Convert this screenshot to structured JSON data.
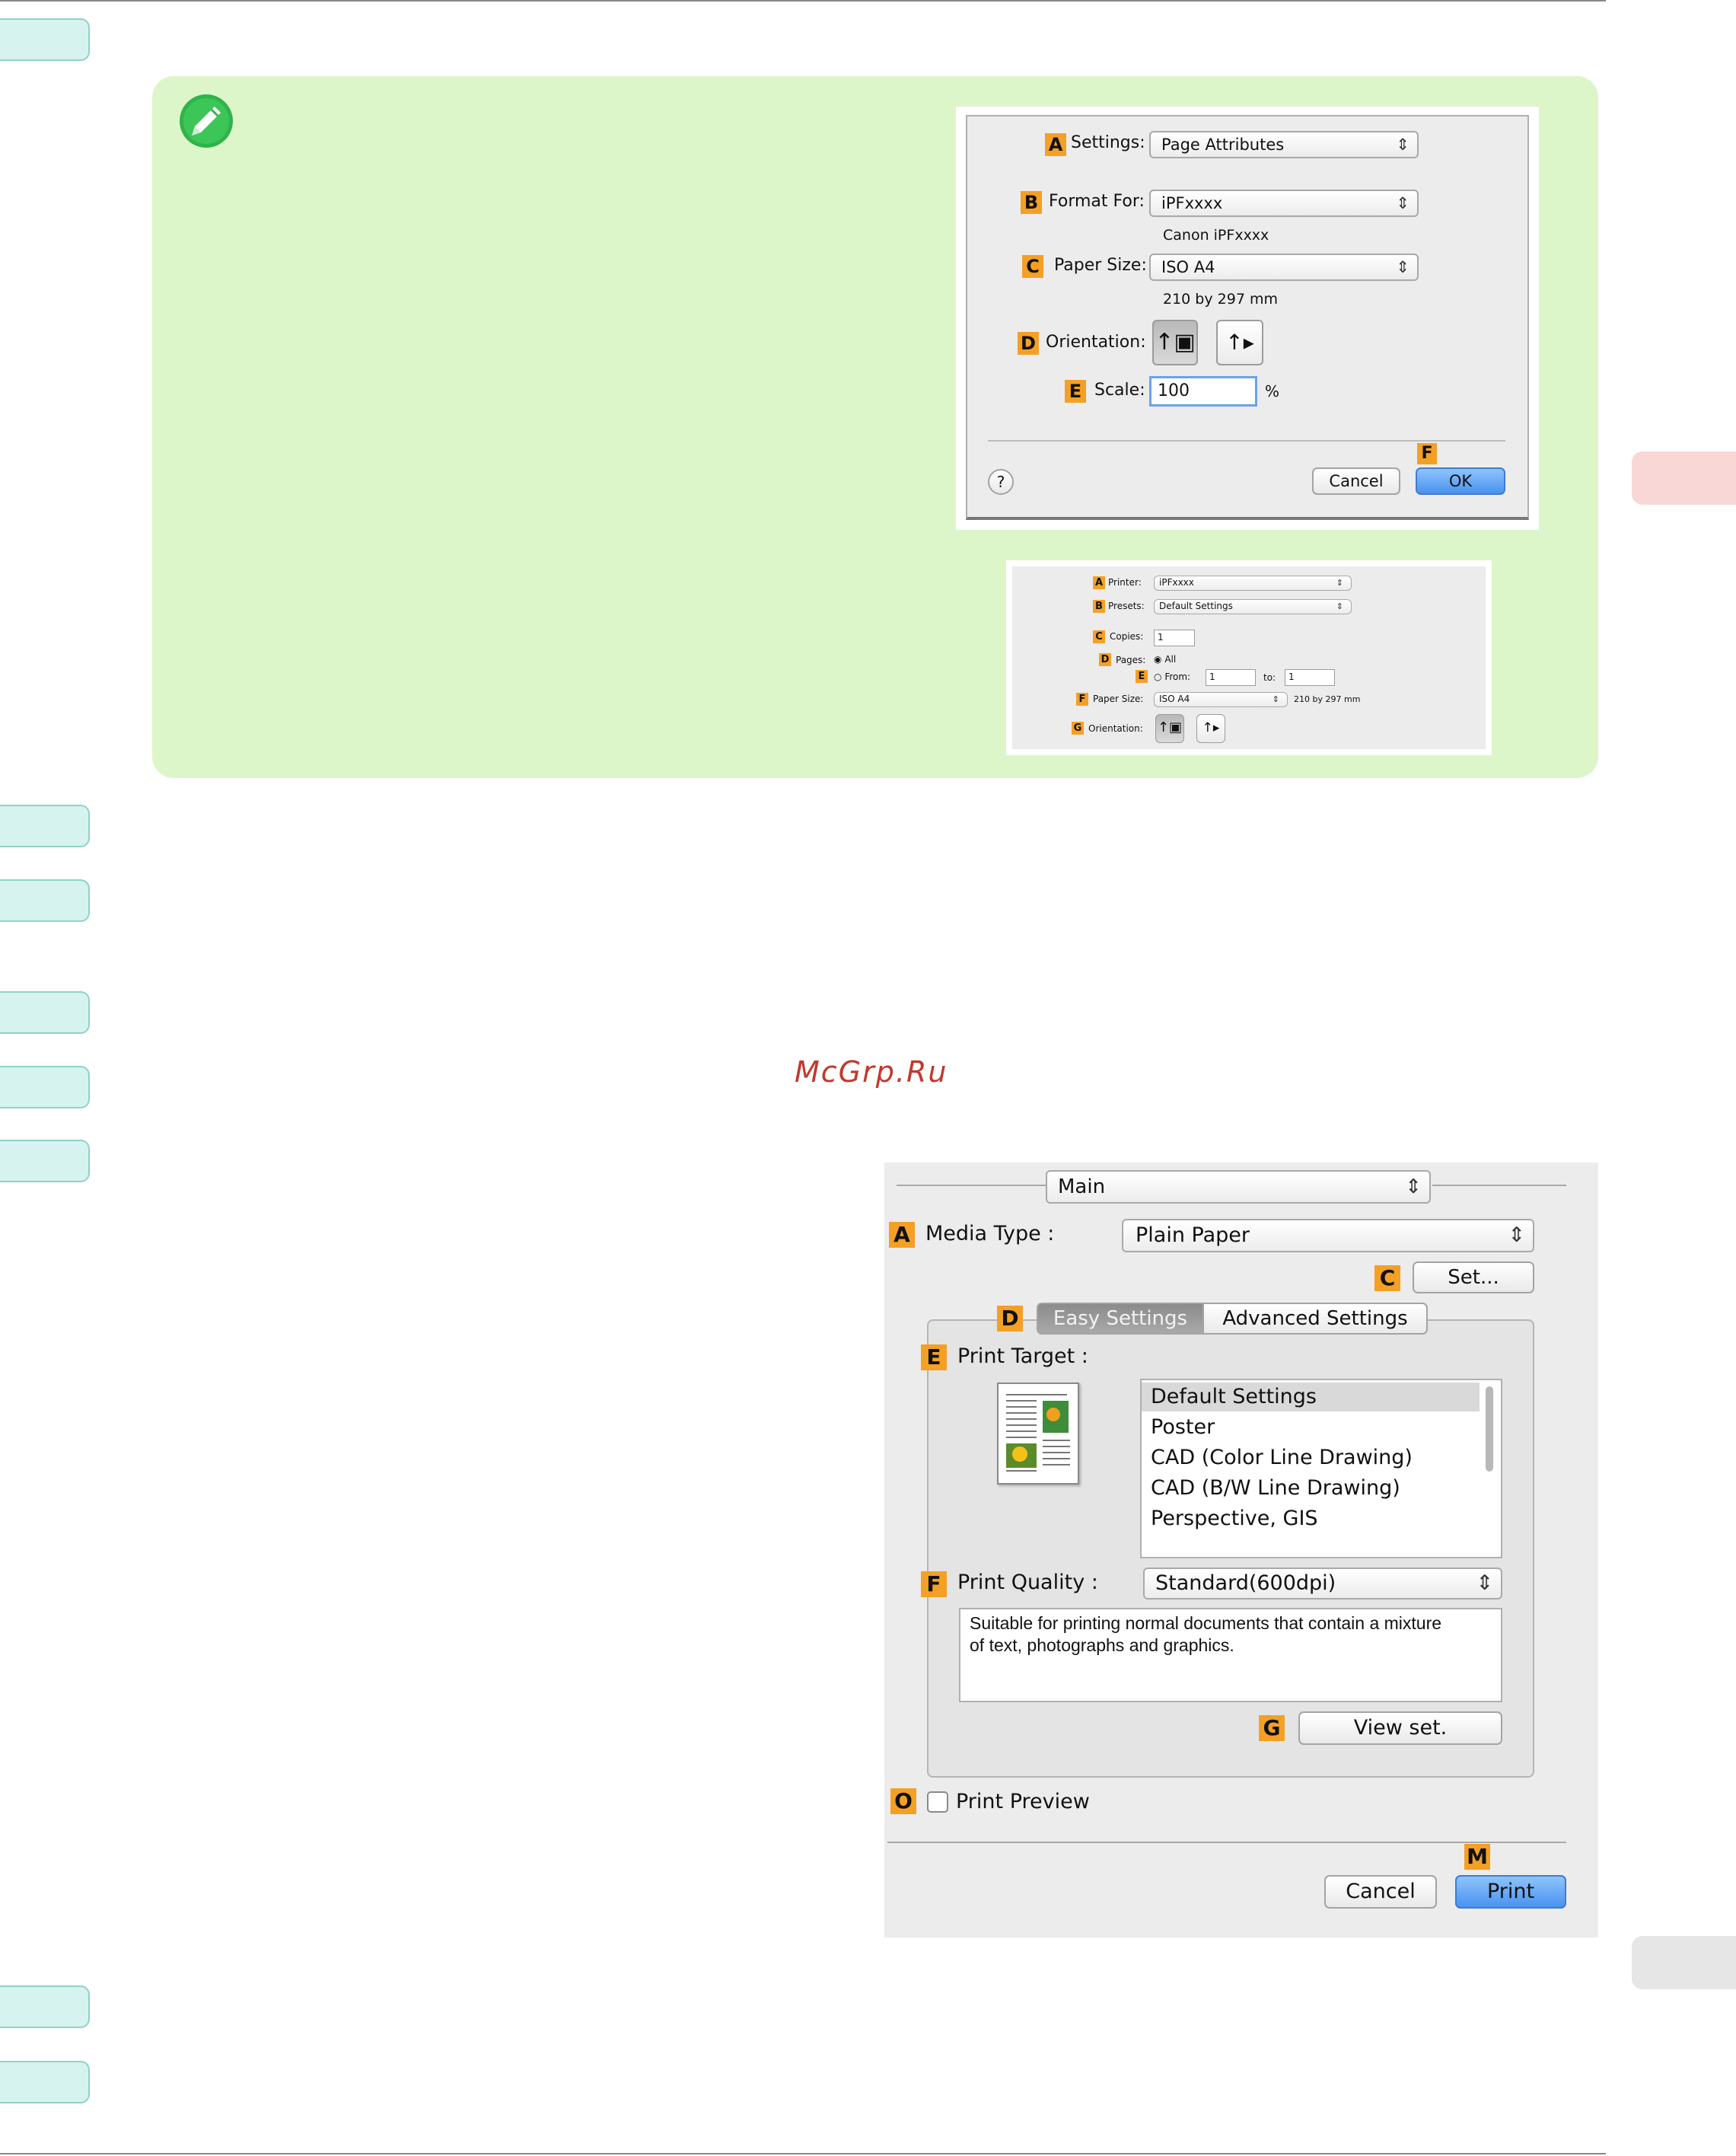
{
  "watermark": "McGrp.Ru",
  "dialog1": {
    "settings_label": "Settings:",
    "settings_value": "Page Attributes",
    "format_label": "Format For:",
    "format_value": "iPFxxxx",
    "format_sub": "Canon iPFxxxx",
    "paper_label": "Paper Size:",
    "paper_value": "ISO A4",
    "paper_sub": "210 by 297 mm",
    "orientation_label": "Orientation:",
    "scale_label": "Scale:",
    "scale_value": "100",
    "scale_unit": "%",
    "help": "?",
    "cancel": "Cancel",
    "ok": "OK",
    "letters": [
      "A",
      "B",
      "C",
      "D",
      "E",
      "F"
    ]
  },
  "dialog2": {
    "printer_label": "Printer:",
    "printer_value": "iPFxxxx",
    "presets_label": "Presets:",
    "presets_value": "Default Settings",
    "copies_label": "Copies:",
    "copies_value": "1",
    "pages_label": "Pages:",
    "pages_all": "All",
    "from_label": "From:",
    "from_value": "1",
    "to_label": "to:",
    "to_value": "1",
    "paper_label": "Paper Size:",
    "paper_value": "ISO A4",
    "paper_sub": "210 by 297 mm",
    "orientation_label": "Orientation:",
    "letters": [
      "A",
      "B",
      "C",
      "D",
      "E",
      "F",
      "G"
    ]
  },
  "dialog3": {
    "panel_value": "Main",
    "media_label": "Media Type :",
    "media_value": "Plain Paper",
    "set_button": "Set...",
    "tab_easy": "Easy Settings",
    "tab_advanced": "Advanced Settings",
    "target_label": "Print Target :",
    "targets": [
      "Default Settings",
      "Poster",
      "CAD (Color Line Drawing)",
      "CAD (B/W Line Drawing)",
      "Perspective, GIS"
    ],
    "quality_label": "Print Quality :",
    "quality_value": "Standard(600dpi)",
    "description": "Suitable for printing normal documents that contain a mixture of text, photographs and graphics.",
    "view_button": "View set.",
    "preview_label": "Print Preview",
    "cancel": "Cancel",
    "print": "Print",
    "letters": [
      "A",
      "C",
      "D",
      "E",
      "F",
      "G",
      "O",
      "M"
    ]
  }
}
